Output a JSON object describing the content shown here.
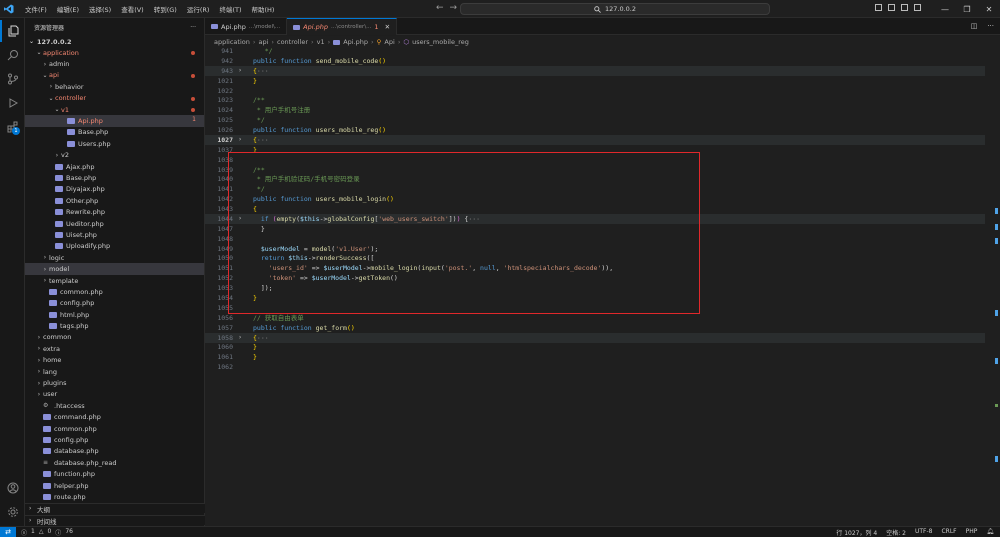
{
  "titlebar": {
    "menu": [
      "文件(F)",
      "编辑(E)",
      "选择(S)",
      "查看(V)",
      "转到(G)",
      "运行(R)",
      "终端(T)",
      "帮助(H)"
    ],
    "search": "127.0.0.2"
  },
  "activity": {
    "extensions_badge": "1"
  },
  "sidebar": {
    "title": "资源管理器",
    "more": "···",
    "root": "127.0.0.2",
    "outline_label": "大纲",
    "timeline_label": "时间线"
  },
  "tree": [
    {
      "label": "application",
      "depth": 1,
      "chev": "⌄",
      "red": true,
      "dot": true
    },
    {
      "label": "admin",
      "depth": 2,
      "chev": "›"
    },
    {
      "label": "api",
      "depth": 2,
      "chev": "⌄",
      "red": true,
      "dot": true
    },
    {
      "label": "behavior",
      "depth": 3,
      "chev": "›"
    },
    {
      "label": "controller",
      "depth": 3,
      "chev": "⌄",
      "red": true,
      "dot": true
    },
    {
      "label": "v1",
      "depth": 4,
      "chev": "⌄",
      "red": true,
      "dot": true
    },
    {
      "label": "Api.php",
      "depth": 5,
      "file": true,
      "red": true,
      "count": "1",
      "selected": true
    },
    {
      "label": "Base.php",
      "depth": 5,
      "file": true
    },
    {
      "label": "Users.php",
      "depth": 5,
      "file": true
    },
    {
      "label": "v2",
      "depth": 4,
      "chev": "›"
    },
    {
      "label": "Ajax.php",
      "depth": 3,
      "file": true
    },
    {
      "label": "Base.php",
      "depth": 3,
      "file": true
    },
    {
      "label": "Diyajax.php",
      "depth": 3,
      "file": true
    },
    {
      "label": "Other.php",
      "depth": 3,
      "file": true
    },
    {
      "label": "Rewrite.php",
      "depth": 3,
      "file": true
    },
    {
      "label": "Ueditor.php",
      "depth": 3,
      "file": true
    },
    {
      "label": "Uiset.php",
      "depth": 3,
      "file": true
    },
    {
      "label": "Uploadify.php",
      "depth": 3,
      "file": true
    },
    {
      "label": "logic",
      "depth": 2,
      "chev": "›"
    },
    {
      "label": "model",
      "depth": 2,
      "chev": "›",
      "selected": true
    },
    {
      "label": "template",
      "depth": 2,
      "chev": "›"
    },
    {
      "label": "common.php",
      "depth": 2,
      "file": true
    },
    {
      "label": "config.php",
      "depth": 2,
      "file": true
    },
    {
      "label": "html.php",
      "depth": 2,
      "file": true
    },
    {
      "label": "tags.php",
      "depth": 2,
      "file": true
    },
    {
      "label": "common",
      "depth": 1,
      "chev": "›"
    },
    {
      "label": "extra",
      "depth": 1,
      "chev": "›"
    },
    {
      "label": "home",
      "depth": 1,
      "chev": "›"
    },
    {
      "label": "lang",
      "depth": 1,
      "chev": "›"
    },
    {
      "label": "plugins",
      "depth": 1,
      "chev": "›"
    },
    {
      "label": "user",
      "depth": 1,
      "chev": "›"
    },
    {
      "label": ".htaccess",
      "depth": 1,
      "file": true,
      "gear": true
    },
    {
      "label": "command.php",
      "depth": 1,
      "file": true
    },
    {
      "label": "common.php",
      "depth": 1,
      "file": true
    },
    {
      "label": "config.php",
      "depth": 1,
      "file": true
    },
    {
      "label": "database.php",
      "depth": 1,
      "file": true
    },
    {
      "label": "database.php_read",
      "depth": 1,
      "file": true,
      "plain": true
    },
    {
      "label": "function.php",
      "depth": 1,
      "file": true
    },
    {
      "label": "helper.php",
      "depth": 1,
      "file": true
    },
    {
      "label": "route.php",
      "depth": 1,
      "file": true
    }
  ],
  "tabs": [
    {
      "name": "Api.php",
      "desc": "...\\model\\...",
      "active": false
    },
    {
      "name": "Api.php",
      "desc": "...\\controller\\...",
      "mod": "1",
      "active": true
    }
  ],
  "breadcrumb": [
    "application",
    "api",
    "controller",
    "v1",
    "Api.php",
    "Api",
    "users_mobile_reg"
  ],
  "code": [
    {
      "n": "941",
      "t": [
        [
          "cm",
          "   */"
        ]
      ]
    },
    {
      "n": "942",
      "t": [
        [
          "kw",
          "public function "
        ],
        [
          "fn",
          "send_mobile_code"
        ],
        [
          "br",
          "()"
        ]
      ]
    },
    {
      "n": "943",
      "fold": "›",
      "hl": true,
      "t": [
        [
          "br",
          "{"
        ],
        [
          "ellip",
          "···"
        ]
      ]
    },
    {
      "n": "1021",
      "t": [
        [
          "br",
          "}"
        ]
      ]
    },
    {
      "n": "1022",
      "t": []
    },
    {
      "n": "1023",
      "t": [
        [
          "cm",
          "/**"
        ]
      ]
    },
    {
      "n": "1024",
      "t": [
        [
          "cm",
          " * 用户手机号注册"
        ]
      ]
    },
    {
      "n": "1025",
      "t": [
        [
          "cm",
          " */"
        ]
      ]
    },
    {
      "n": "1026",
      "t": [
        [
          "kw",
          "public function "
        ],
        [
          "fn",
          "users_mobile_reg"
        ],
        [
          "br",
          "()"
        ]
      ]
    },
    {
      "n": "1027",
      "fold": "›",
      "hl": true,
      "cur": true,
      "t": [
        [
          "br",
          "{"
        ],
        [
          "ellip",
          "···"
        ]
      ]
    },
    {
      "n": "1037",
      "t": [
        [
          "br",
          "}"
        ]
      ]
    },
    {
      "n": "1038",
      "t": []
    },
    {
      "n": "1039",
      "t": [
        [
          "cm",
          "/**"
        ]
      ]
    },
    {
      "n": "1040",
      "t": [
        [
          "cm",
          " * 用户手机验证码/手机号密码登录"
        ]
      ]
    },
    {
      "n": "1041",
      "t": [
        [
          "cm",
          " */"
        ]
      ]
    },
    {
      "n": "1042",
      "t": [
        [
          "kw",
          "public function "
        ],
        [
          "fn",
          "users_mobile_login"
        ],
        [
          "br",
          "()"
        ]
      ]
    },
    {
      "n": "1043",
      "t": [
        [
          "br",
          "{"
        ]
      ]
    },
    {
      "n": "1044",
      "fold": "›",
      "hl": true,
      "t": [
        [
          "kw",
          "  if "
        ],
        [
          "br2",
          "("
        ],
        [
          "fn",
          "empty"
        ],
        [
          "pl",
          "("
        ],
        [
          "vr",
          "$this"
        ],
        [
          "pl",
          "->"
        ],
        [
          "fn",
          "globalConfig"
        ],
        [
          "pl",
          "["
        ],
        [
          "st",
          "'web_users_switch'"
        ],
        [
          "pl",
          "])"
        ],
        [
          "br2",
          ")"
        ],
        [
          "pl",
          " {"
        ],
        [
          "ellip",
          "···"
        ]
      ]
    },
    {
      "n": "1047",
      "t": [
        [
          "pl",
          "  }"
        ]
      ]
    },
    {
      "n": "1048",
      "t": []
    },
    {
      "n": "1049",
      "t": [
        [
          "vr",
          "  $userModel"
        ],
        [
          "pl",
          " = "
        ],
        [
          "fn",
          "model"
        ],
        [
          "pl",
          "("
        ],
        [
          "st",
          "'v1.User'"
        ],
        [
          "pl",
          ");"
        ]
      ]
    },
    {
      "n": "1050",
      "t": [
        [
          "kw",
          "  return "
        ],
        [
          "vr",
          "$this"
        ],
        [
          "pl",
          "->"
        ],
        [
          "fn",
          "renderSuccess"
        ],
        [
          "pl",
          "(["
        ]
      ]
    },
    {
      "n": "1051",
      "t": [
        [
          "st",
          "    'users_id'"
        ],
        [
          "pl",
          " => "
        ],
        [
          "vr",
          "$userModel"
        ],
        [
          "pl",
          "->"
        ],
        [
          "fn",
          "mobile_login"
        ],
        [
          "pl",
          "("
        ],
        [
          "fn",
          "input"
        ],
        [
          "pl",
          "("
        ],
        [
          "st",
          "'post.'"
        ],
        [
          "pl",
          ", "
        ],
        [
          "kw",
          "null"
        ],
        [
          "pl",
          ", "
        ],
        [
          "st",
          "'htmlspecialchars_decode'"
        ],
        [
          "pl",
          ")),"
        ]
      ]
    },
    {
      "n": "1052",
      "t": [
        [
          "st",
          "    'token'"
        ],
        [
          "pl",
          " => "
        ],
        [
          "vr",
          "$userModel"
        ],
        [
          "pl",
          "->"
        ],
        [
          "fn",
          "getToken"
        ],
        [
          "pl",
          "()"
        ]
      ]
    },
    {
      "n": "1053",
      "t": [
        [
          "pl",
          "  ]);"
        ]
      ]
    },
    {
      "n": "1054",
      "t": [
        [
          "br",
          "}"
        ]
      ]
    },
    {
      "n": "1055",
      "t": []
    },
    {
      "n": "1056",
      "t": [
        [
          "cm",
          "// 获取自由表单"
        ]
      ]
    },
    {
      "n": "1057",
      "t": [
        [
          "kw",
          "public function "
        ],
        [
          "fn",
          "get_form"
        ],
        [
          "br",
          "()"
        ]
      ]
    },
    {
      "n": "1058",
      "fold": "›",
      "hl": true,
      "t": [
        [
          "br",
          "{"
        ],
        [
          "ellip",
          "···"
        ]
      ]
    },
    {
      "n": "1060",
      "t": [
        [
          "br",
          "}"
        ]
      ]
    },
    {
      "n": "1061",
      "t": [
        [
          "br",
          "}"
        ]
      ]
    },
    {
      "n": "1062",
      "t": []
    }
  ],
  "statusbar": {
    "errors": "1",
    "warnings": "0",
    "info": "76",
    "position": "行 1027，列 4",
    "spaces": "空格: 2",
    "encoding": "UTF-8",
    "eol": "CRLF",
    "language": "PHP"
  },
  "colors": {
    "accent": "#0078d4",
    "annotation": "#e0282b",
    "modified": "#f48771"
  }
}
